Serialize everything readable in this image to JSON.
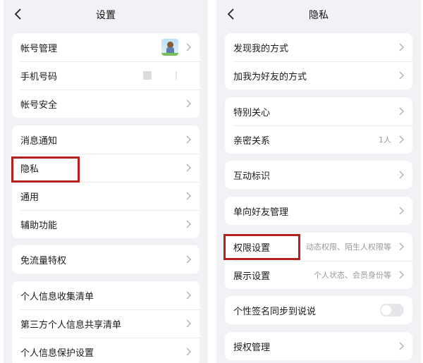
{
  "settings": {
    "title": "设置",
    "groups": [
      [
        {
          "label": "帐号管理",
          "extra": "avatar"
        },
        {
          "label": "手机号码",
          "extra": "masked"
        },
        {
          "label": "帐号安全"
        }
      ],
      [
        {
          "label": "消息通知"
        },
        {
          "label": "隐私",
          "highlighted": true
        },
        {
          "label": "通用"
        },
        {
          "label": "辅助功能"
        }
      ],
      [
        {
          "label": "免流量特权"
        }
      ],
      [
        {
          "label": "个人信息收集清单"
        },
        {
          "label": "第三方个人信息共享清单"
        },
        {
          "label": "个人信息保护设置"
        }
      ]
    ]
  },
  "privacy": {
    "title": "隐私",
    "groups": [
      [
        {
          "label": "发现我的方式"
        },
        {
          "label": "加我为好友的方式"
        }
      ],
      [
        {
          "label": "特别关心"
        },
        {
          "label": "亲密关系",
          "value": "1人"
        }
      ],
      [
        {
          "label": "互动标识"
        }
      ],
      [
        {
          "label": "单向好友管理"
        }
      ],
      [
        {
          "label": "权限设置",
          "value": "动态权限、陌生人权限等",
          "highlighted": true
        },
        {
          "label": "展示设置",
          "value": "个人状态、会员身份等"
        }
      ],
      [
        {
          "label": "个性签名同步到说说",
          "toggle": false
        }
      ],
      [
        {
          "label": "授权管理"
        }
      ]
    ]
  },
  "colors": {
    "page_background": "#f2f2f6",
    "card_background": "#ffffff",
    "highlight_border": "#b3211c",
    "secondary_text": "#9a9a9a"
  },
  "icons": [
    "back-arrow-icon",
    "chevron-right-icon"
  ]
}
